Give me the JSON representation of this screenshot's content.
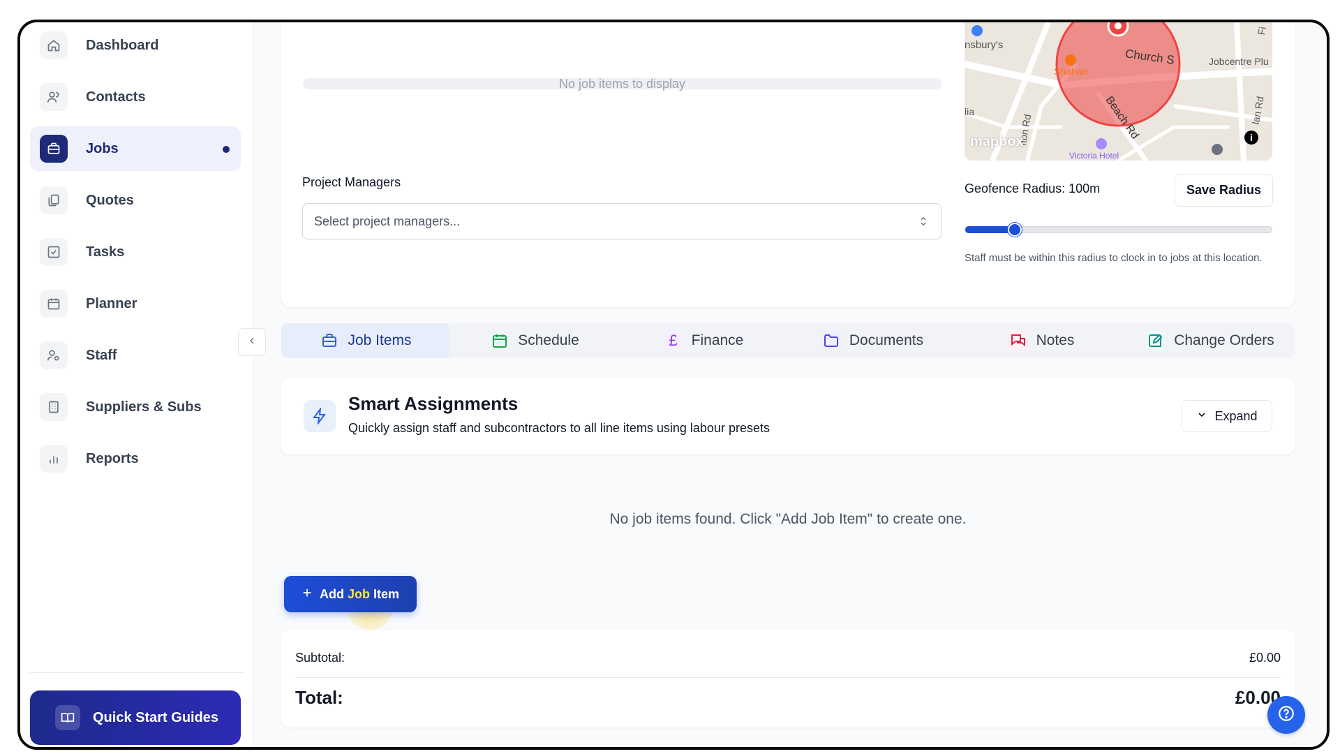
{
  "sidebar": {
    "items": [
      {
        "label": "Dashboard",
        "icon": "home-icon"
      },
      {
        "label": "Contacts",
        "icon": "users-icon"
      },
      {
        "label": "Jobs",
        "icon": "briefcase-icon",
        "active": true
      },
      {
        "label": "Quotes",
        "icon": "documents-icon"
      },
      {
        "label": "Tasks",
        "icon": "checkbox-icon"
      },
      {
        "label": "Planner",
        "icon": "calendar-icon"
      },
      {
        "label": "Staff",
        "icon": "user-settings-icon"
      },
      {
        "label": "Suppliers & Subs",
        "icon": "building-icon"
      },
      {
        "label": "Reports",
        "icon": "bar-chart-icon"
      }
    ],
    "quick_start": "Quick Start Guides"
  },
  "top_card": {
    "no_items": "No job items to display",
    "project_managers_label": "Project Managers",
    "project_managers_placeholder": "Select project managers...",
    "map": {
      "labels": [
        "nsbury's",
        "Church S",
        "Jobcentre Plu",
        "Shahan",
        "Beach Rd",
        "fton Rd",
        "lan Rd",
        "lia",
        "Victoria Hotel",
        "Fi"
      ],
      "attribution": "mapbox"
    },
    "geofence_label": "Geofence Radius: 100m",
    "geofence_radius_m": 100,
    "slider_fraction": 0.16,
    "save_radius": "Save Radius",
    "geofence_help": "Staff must be within this radius to clock in to jobs at this location."
  },
  "tabs": [
    {
      "label": "Job Items",
      "icon": "briefcase-icon",
      "color": "#3b5bdb",
      "active": true
    },
    {
      "label": "Schedule",
      "icon": "calendar-icon",
      "color": "#16a34a"
    },
    {
      "label": "Finance",
      "icon": "pound-icon",
      "color": "#9333ea"
    },
    {
      "label": "Documents",
      "icon": "folder-icon",
      "color": "#4f46e5"
    },
    {
      "label": "Notes",
      "icon": "chat-icon",
      "color": "#e11d48"
    },
    {
      "label": "Change Orders",
      "icon": "edit-icon",
      "color": "#0d9488"
    }
  ],
  "smart_assignments": {
    "title": "Smart Assignments",
    "subtitle": "Quickly assign staff and subcontractors to all line items using labour presets",
    "expand": "Expand"
  },
  "empty_message": "No job items found. Click \"Add Job Item\" to create one.",
  "add_button": {
    "prefix": "Add ",
    "highlight": "Job",
    "suffix": " Item"
  },
  "totals": {
    "subtotal_label": "Subtotal:",
    "subtotal_value": "£0.00",
    "total_label": "Total:",
    "total_value": "£0.00"
  },
  "colors": {
    "primary": "#1d4ed8",
    "sidebar_active": "#1e2a78"
  }
}
